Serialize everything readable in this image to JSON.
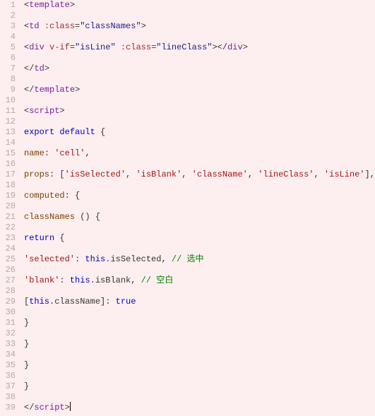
{
  "lines": [
    {
      "n": "1",
      "html": "<span class='punc'>&lt;</span><span class='tag'>template</span><span class='punc'>&gt;</span>"
    },
    {
      "n": "2",
      "html": ""
    },
    {
      "n": "3",
      "html": "<span class='punc'>&lt;</span><span class='tag'>td</span> <span class='attr-name'>:class</span><span class='punc'>=</span><span class='attr-value'>\"classNames\"</span><span class='punc'>&gt;</span>"
    },
    {
      "n": "4",
      "html": ""
    },
    {
      "n": "5",
      "html": "<span class='punc'>&lt;</span><span class='tag'>div</span> <span class='attr-name'>v-if</span><span class='punc'>=</span><span class='attr-value'>\"isLine\"</span> <span class='attr-name'>:class</span><span class='punc'>=</span><span class='attr-value'>\"lineClass\"</span><span class='punc'>&gt;&lt;/</span><span class='tag'>div</span><span class='punc'>&gt;</span>"
    },
    {
      "n": "6",
      "html": ""
    },
    {
      "n": "7",
      "html": "<span class='punc'>&lt;/</span><span class='tag'>td</span><span class='punc'>&gt;</span>"
    },
    {
      "n": "8",
      "html": ""
    },
    {
      "n": "9",
      "html": "<span class='punc'>&lt;/</span><span class='tag'>template</span><span class='punc'>&gt;</span>"
    },
    {
      "n": "10",
      "html": ""
    },
    {
      "n": "11",
      "html": "<span class='punc'>&lt;</span><span class='tag'>script</span><span class='punc'>&gt;</span>"
    },
    {
      "n": "12",
      "html": ""
    },
    {
      "n": "13",
      "html": "<span class='keyword'>export</span> <span class='keyword'>default</span> <span class='punc'>{</span>"
    },
    {
      "n": "14",
      "html": ""
    },
    {
      "n": "15",
      "html": "<span class='prop'>name</span><span class='punc'>:</span> <span class='string'>'cell'</span><span class='punc'>,</span>"
    },
    {
      "n": "16",
      "html": ""
    },
    {
      "n": "17",
      "html": "<span class='prop'>props</span><span class='punc'>:</span> <span class='punc'>[</span><span class='string'>'isSelected'</span><span class='punc'>,</span> <span class='string'>'isBlank'</span><span class='punc'>,</span> <span class='string'>'className'</span><span class='punc'>,</span> <span class='string'>'lineClass'</span><span class='punc'>,</span> <span class='string'>'isLine'</span><span class='punc'>],</span>"
    },
    {
      "n": "18",
      "html": ""
    },
    {
      "n": "19",
      "html": "<span class='prop'>computed</span><span class='punc'>:</span> <span class='punc'>{</span>"
    },
    {
      "n": "20",
      "html": ""
    },
    {
      "n": "21",
      "html": "<span class='prop'>classNames</span> <span class='punc'>() {</span>"
    },
    {
      "n": "22",
      "html": ""
    },
    {
      "n": "23",
      "html": "<span class='keyword'>return</span> <span class='punc'>{</span>"
    },
    {
      "n": "24",
      "html": ""
    },
    {
      "n": "25",
      "html": "<span class='string'>'selected'</span><span class='punc'>:</span> <span class='keyword'>this</span><span class='punc'>.</span>isSelected<span class='punc'>,</span> <span class='comment'>// 选中</span>"
    },
    {
      "n": "26",
      "html": ""
    },
    {
      "n": "27",
      "html": "<span class='string'>'blank'</span><span class='punc'>:</span> <span class='keyword'>this</span><span class='punc'>.</span>isBlank<span class='punc'>,</span> <span class='comment'>// 空白</span>"
    },
    {
      "n": "28",
      "html": ""
    },
    {
      "n": "29",
      "html": "<span class='punc'>[</span><span class='keyword'>this</span><span class='punc'>.</span>className<span class='punc'>]:</span> <span class='keyword'>true</span>"
    },
    {
      "n": "30",
      "html": ""
    },
    {
      "n": "31",
      "html": "<span class='punc'>}</span>"
    },
    {
      "n": "32",
      "html": ""
    },
    {
      "n": "33",
      "html": "<span class='punc'>}</span>"
    },
    {
      "n": "34",
      "html": ""
    },
    {
      "n": "35",
      "html": "<span class='punc'>}</span>"
    },
    {
      "n": "36",
      "html": ""
    },
    {
      "n": "37",
      "html": "<span class='punc'>}</span>"
    },
    {
      "n": "38",
      "html": ""
    },
    {
      "n": "39",
      "html": "<span class='punc'>&lt;/</span><span class='tag'>script</span><span class='punc'>&gt;</span><span class='cursor'></span>"
    }
  ]
}
